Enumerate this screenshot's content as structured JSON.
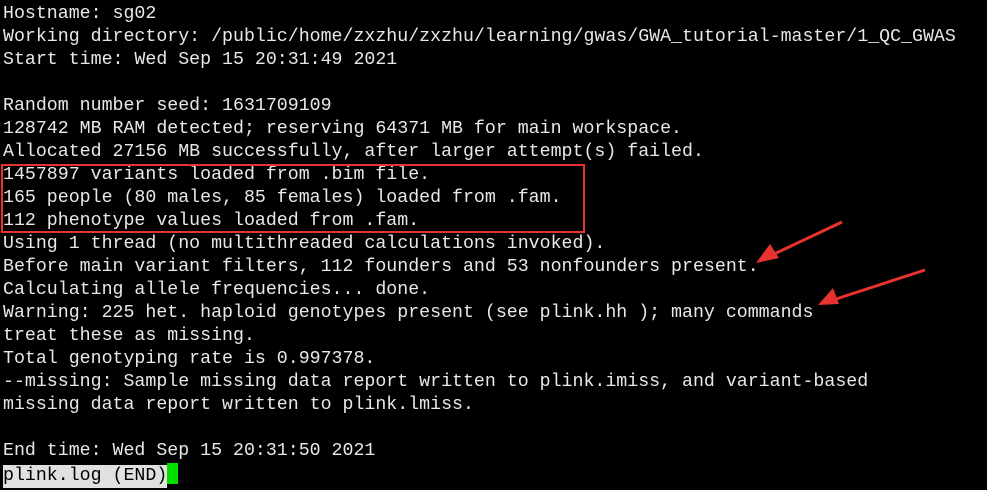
{
  "terminal": {
    "lines": [
      "Hostname: sg02",
      "Working directory: /public/home/zxzhu/zxzhu/learning/gwas/GWA_tutorial-master/1_QC_GWAS",
      "Start time: Wed Sep 15 20:31:49 2021",
      "",
      "Random number seed: 1631709109",
      "128742 MB RAM detected; reserving 64371 MB for main workspace.",
      "Allocated 27156 MB successfully, after larger attempt(s) failed.",
      "1457897 variants loaded from .bim file.",
      "165 people (80 males, 85 females) loaded from .fam.",
      "112 phenotype values loaded from .fam.",
      "Using 1 thread (no multithreaded calculations invoked).",
      "Before main variant filters, 112 founders and 53 nonfounders present.",
      "Calculating allele frequencies... done.",
      "Warning: 225 het. haploid genotypes present (see plink.hh ); many commands",
      "treat these as missing.",
      "Total genotyping rate is 0.997378.",
      "--missing: Sample missing data report written to plink.imiss, and variant-based",
      "missing data report written to plink.lmiss.",
      "",
      "End time: Wed Sep 15 20:31:50 2021"
    ],
    "status": "plink.log (END)"
  },
  "colors": {
    "highlight_box": "#e8322f",
    "arrow": "#e8322f",
    "cursor": "#00e000",
    "text": "#e8e8e8",
    "background": "#000000"
  }
}
